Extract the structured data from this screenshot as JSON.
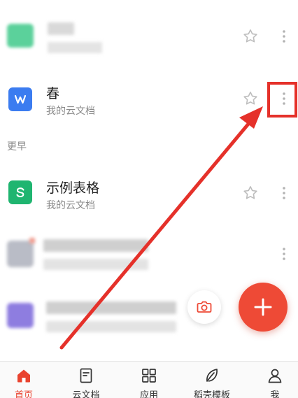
{
  "files": [
    {
      "title": "春",
      "subtitle": "我的云文档",
      "icon": "wps-writer-icon",
      "icon_letter": "W",
      "icon_color": "#3b7cf0"
    },
    {
      "title": "示例表格",
      "subtitle": "我的云文档",
      "icon": "wps-sheet-icon",
      "icon_letter": "S",
      "icon_color": "#1fb570"
    }
  ],
  "section_label": "更早",
  "tabs": [
    {
      "label": "首页",
      "icon": "home-icon",
      "active": true
    },
    {
      "label": "云文档",
      "icon": "cloud-doc-icon",
      "active": false
    },
    {
      "label": "应用",
      "icon": "apps-grid-icon",
      "active": false
    },
    {
      "label": "稻壳模板",
      "icon": "leaf-template-icon",
      "active": false
    },
    {
      "label": "我",
      "icon": "person-icon",
      "active": false
    }
  ],
  "colors": {
    "accent": "#ee4a36",
    "annotation": "#e5312a",
    "active_tab": "#e9432f"
  }
}
